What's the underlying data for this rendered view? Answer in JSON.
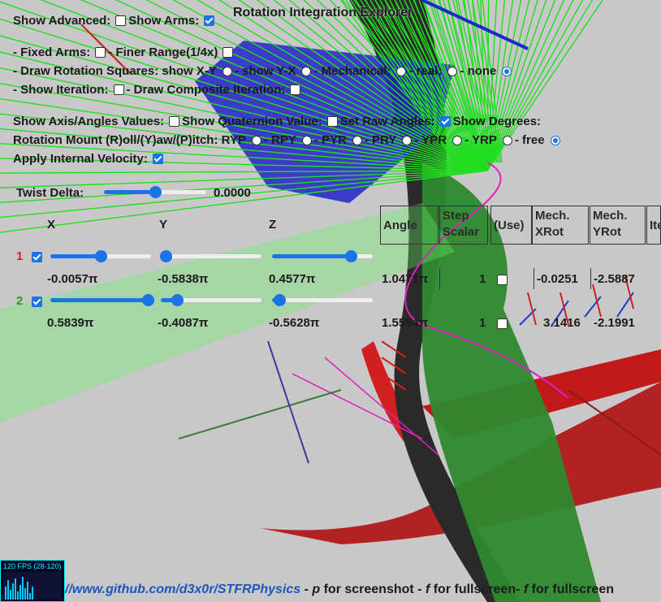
{
  "title": "Rotation Integration Explorer",
  "controls": {
    "show_advanced_label": "Show Advanced:",
    "show_advanced_checked": false,
    "show_arms_label": "Show Arms:",
    "show_arms_checked": true,
    "fixed_arms_label": "- Fixed Arms:",
    "fixed_arms_checked": false,
    "finer_range_label": "- Finer Range(1/4x)",
    "finer_range_checked": false,
    "draw_squares_label": "- Draw Rotation Squares: show X-Y",
    "show_yx_label": "- show Y-X",
    "mechanical_label": "- Mechanical:",
    "real_label": "- real:",
    "none_label": "- none",
    "squares_selected": "none",
    "show_iteration_label": "- Show Iteration:",
    "show_iteration_checked": false,
    "draw_composite_label": "- Draw Composite Iteration:",
    "draw_composite_checked": false,
    "show_axis_label": "Show Axis/Angles Values:",
    "show_axis_checked": false,
    "show_quaternion_label": "Show Quaternion Value:",
    "show_quaternion_checked": false,
    "set_raw_label": "Set Raw Angles:",
    "set_raw_checked": true,
    "show_degrees_label": "Show Degrees:",
    "mount_label": "Rotation Mount (R)oll/(Y)aw/(P)itch: RYP",
    "mount_options": [
      "- RPY",
      "- PYR",
      "- PRY",
      "- YPR",
      "- YRP",
      "- free"
    ],
    "mount_selected": "free",
    "apply_velocity_label": "Apply Internal Velocity:",
    "apply_velocity_checked": true,
    "twist_label": "Twist Delta:",
    "twist_value": "0.0000",
    "twist_fraction": 0.5
  },
  "table": {
    "axis_headers": [
      "X",
      "Y",
      "Z"
    ],
    "headers": [
      "Angle",
      "Step\nScalar",
      "(Use)",
      "Mech.\nXRot",
      "Mech.\nYRot",
      "Ite"
    ],
    "rows": [
      {
        "index": "1",
        "index_color": "#e02020",
        "checked": true,
        "sliders": [
          0.5,
          0.05,
          0.78
        ],
        "x": "-0.0057π",
        "y": "-0.5838π",
        "z": "0.4577π",
        "angle": "1.0471π",
        "step": "1",
        "use_checked": false,
        "mech_x": "-0.0251",
        "mech_y": "-2.5887"
      },
      {
        "index": "2",
        "index_color": "#20a020",
        "checked": true,
        "sliders": [
          0.97,
          0.16,
          0.07
        ],
        "x": "0.5839π",
        "y": "-0.4087π",
        "z": "-0.5628π",
        "angle": "1.5554π",
        "step": "1",
        "use_checked": false,
        "mech_x": "3.1416",
        "mech_y": "-2.1991"
      }
    ]
  },
  "fps": {
    "text": "120 FPS (28-120)"
  },
  "footer": {
    "link": "//www.github.com/d3x0r/STFRPhysics",
    "part1": " - ",
    "key1": "p",
    "part2": " for screenshot - ",
    "key2": "f",
    "part3": " for fullscreen- ",
    "key3": "f",
    "part4": " for fullscreen"
  }
}
